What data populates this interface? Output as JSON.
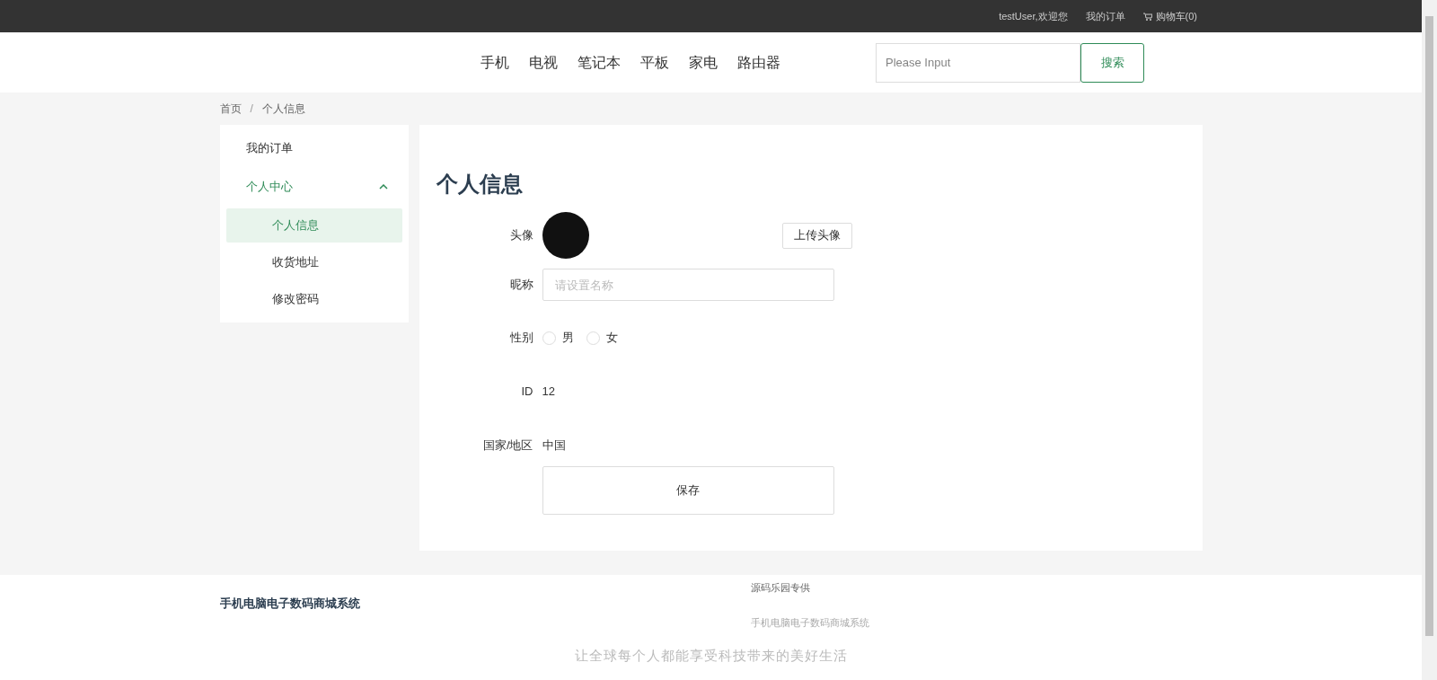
{
  "top_bar": {
    "welcome": "testUser,欢迎您",
    "links": [
      "我的订单",
      "购物车(0)"
    ]
  },
  "nav": {
    "items": [
      "手机",
      "电视",
      "笔记本",
      "平板",
      "家电",
      "路由器"
    ],
    "search": {
      "placeholder": "Please Input",
      "button": "搜索"
    }
  },
  "breadcrumb": [
    "首页",
    "个人信息"
  ],
  "breadcrumb_separator": "/",
  "sidebar": {
    "items": [
      {
        "label": "我的订单",
        "selected": false
      },
      {
        "label": "个人中心",
        "selected": false,
        "expanded": true,
        "children": [
          {
            "label": "个人信息",
            "selected": true
          },
          {
            "label": "收货地址",
            "selected": false
          },
          {
            "label": "修改密码",
            "selected": false
          }
        ]
      }
    ]
  },
  "form": {
    "title": "个人信息",
    "avatar_label": "头像",
    "upload_button": "上传头像",
    "nickname_label": "昵称",
    "nickname_placeholder": "请设置名称",
    "gender_label": "性别",
    "genders": [
      {
        "label": "男",
        "selected": false
      },
      {
        "label": "女",
        "selected": false
      }
    ],
    "id_label": "ID",
    "id_value": "12",
    "region_label": "国家/地区",
    "region_value": "中国",
    "save_button": "保存"
  },
  "footer": {
    "brand": "手机电脑电子数码商城系统",
    "provider": "源码乐园专供",
    "subtitle": "手机电脑电子数码商城系统",
    "slogan": "让全球每个人都能享受科技带来的美好生活"
  }
}
